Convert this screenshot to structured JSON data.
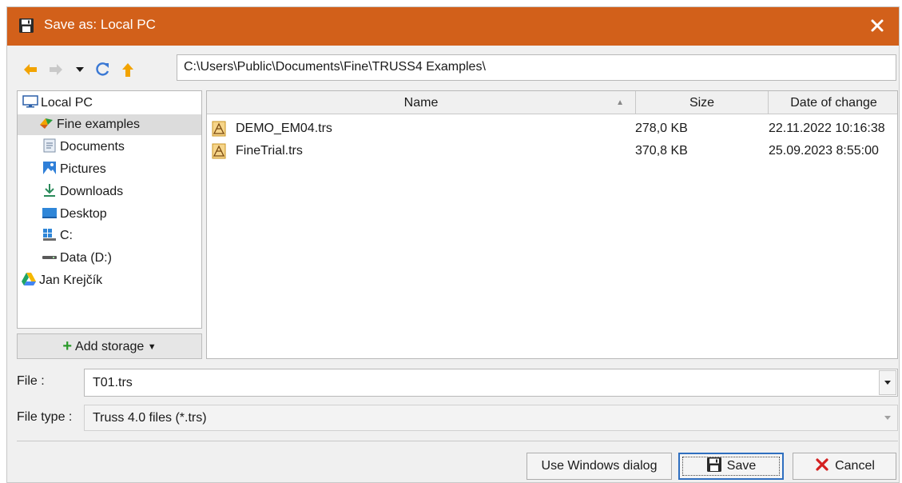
{
  "window": {
    "title": "Save as: Local PC",
    "title_bar_color": "#d2601a",
    "icons": {
      "app": "floppy-disk-icon",
      "close": "close-icon"
    }
  },
  "navigation": {
    "path": "C:\\Users\\Public\\Documents\\Fine\\TRUSS4 Examples\\",
    "icons": {
      "back": "arrow-left-icon",
      "forward": "arrow-right-icon",
      "history": "chevron-down-icon",
      "refresh": "refresh-icon",
      "up": "arrow-up-icon"
    }
  },
  "sidebar": {
    "items": [
      {
        "label": "Local PC",
        "icon": "monitor-icon"
      },
      {
        "label": "Fine examples",
        "icon": "fine-logo-icon",
        "selected": true
      },
      {
        "label": "Documents",
        "icon": "documents-icon"
      },
      {
        "label": "Pictures",
        "icon": "pictures-icon"
      },
      {
        "label": "Downloads",
        "icon": "download-icon"
      },
      {
        "label": "Desktop",
        "icon": "desktop-icon"
      },
      {
        "label": "C:",
        "icon": "drive-c-icon"
      },
      {
        "label": "Data (D:)",
        "icon": "drive-icon"
      },
      {
        "label": "Jan Krejčík",
        "icon": "google-drive-icon"
      }
    ],
    "add_storage_label": "Add storage"
  },
  "file_list": {
    "columns": {
      "name": "Name",
      "size": "Size",
      "date": "Date of change"
    },
    "sort_column": "Name",
    "rows": [
      {
        "name": "DEMO_EM04.trs",
        "size": "278,0 KB",
        "date": "22.11.2022 10:16:38",
        "icon": "truss-file-icon"
      },
      {
        "name": "FineTrial.trs",
        "size": "370,8 KB",
        "date": "25.09.2023 8:55:00",
        "icon": "truss-file-icon"
      }
    ]
  },
  "form": {
    "file_label": "File :",
    "file_value": "T01.trs",
    "file_type_label": "File type :",
    "file_type_value": "Truss 4.0 files (*.trs)"
  },
  "buttons": {
    "windows_dialog": "Use Windows dialog",
    "save": "Save",
    "cancel": "Cancel"
  }
}
